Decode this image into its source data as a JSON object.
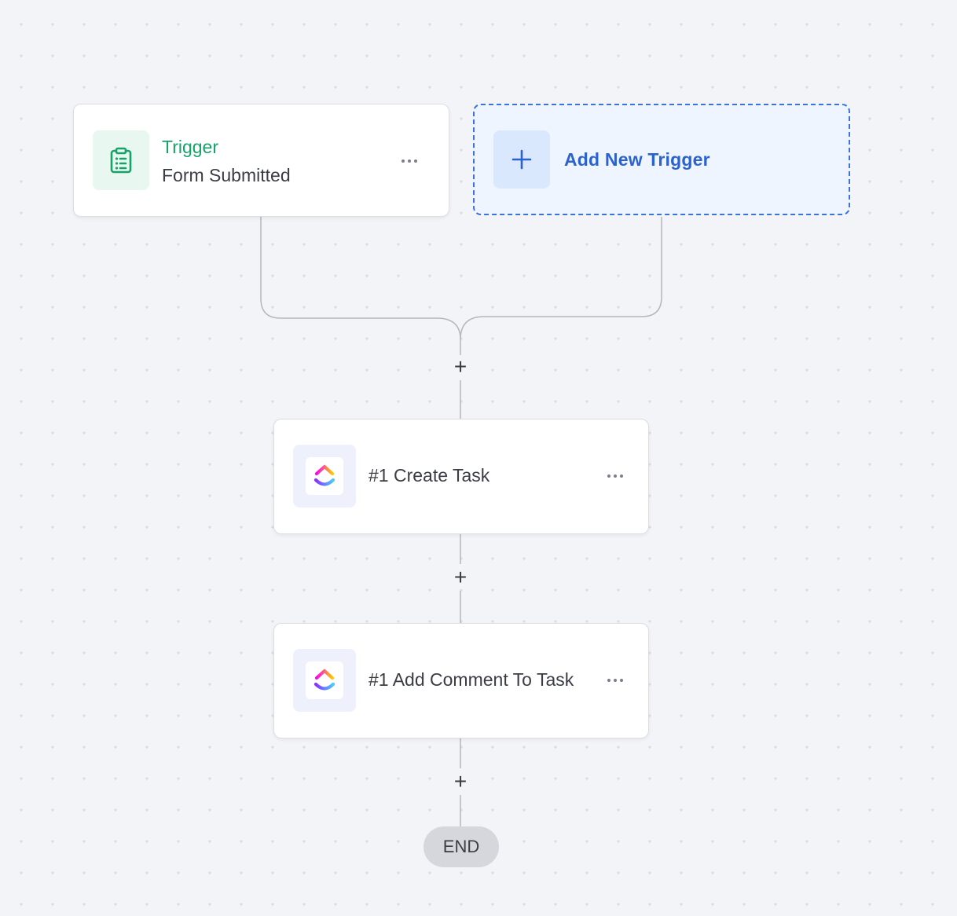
{
  "trigger_card": {
    "title": "Trigger",
    "subtitle": "Form Submitted",
    "icon": "clipboard-list-icon",
    "title_color": "#16a36a"
  },
  "add_trigger": {
    "label": "Add New Trigger",
    "icon": "plus-icon",
    "accent": "#2b62cf"
  },
  "steps": [
    {
      "label": "#1 Create Task",
      "icon": "clickup-logo-icon"
    },
    {
      "label": "#1 Add Comment To Task",
      "icon": "clickup-logo-icon"
    }
  ],
  "add_step_symbol": "+",
  "end_label": "END"
}
